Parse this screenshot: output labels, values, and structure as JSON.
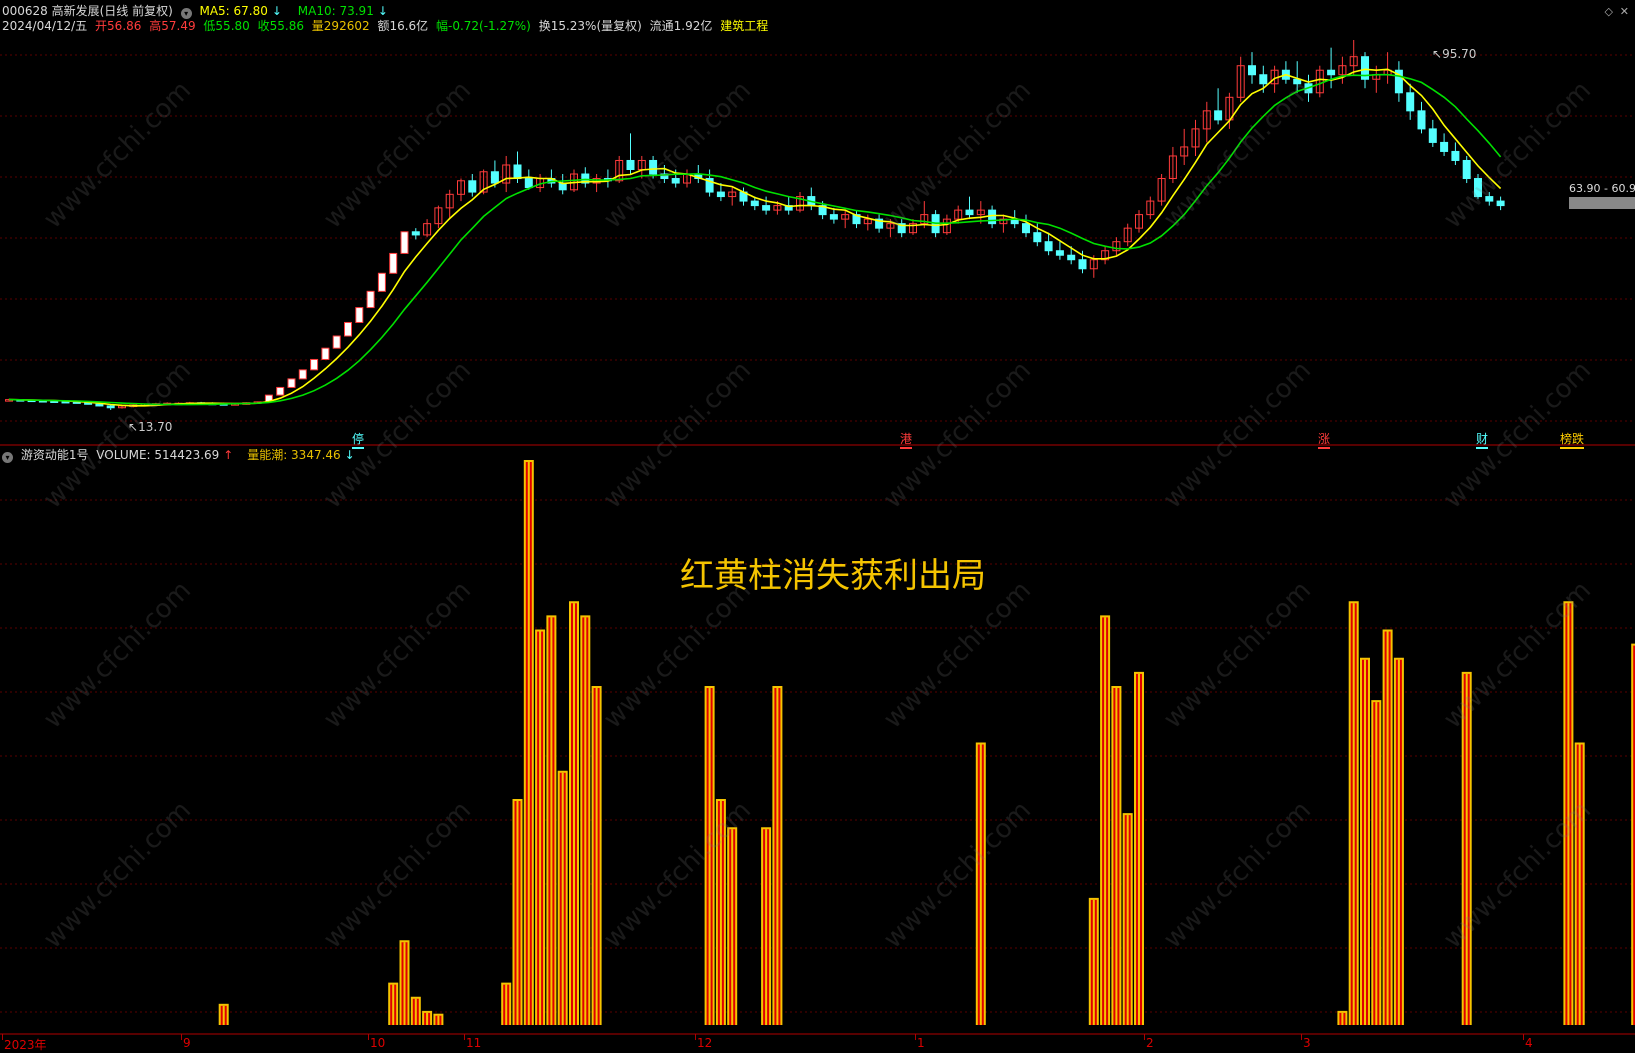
{
  "header1": {
    "code_name": "000628 高新发展(日线 前复权)",
    "ma5": "MA5: 67.80",
    "ma5_arrow": "↓",
    "ma10": "MA10: 73.91",
    "ma10_arrow": "↓"
  },
  "header2": {
    "date": "2024/04/12/五",
    "open": "开56.86",
    "high": "高57.49",
    "low": "低55.80",
    "close": "收55.86",
    "volume": "量292602",
    "amount": "额16.6亿",
    "change": "幅-0.72(-1.27%)",
    "turnover": "换15.23%(量复权)",
    "float": "流通1.92亿",
    "sector": "建筑工程"
  },
  "lower_header": {
    "indicator": "游资动能1号",
    "volume_label": "VOLUME: 514423.69",
    "volume_arrow": "↑",
    "energy_label": "量能潮: 3347.46",
    "energy_arrow": "↓"
  },
  "price_labels": {
    "high_mark": "95.70",
    "low_mark": "13.70",
    "range_tag": "63.90 - 60.9"
  },
  "event_tags": [
    "停",
    "港",
    "涨",
    "财",
    "榜跌"
  ],
  "annotation": "红黄柱消失获利出局",
  "watermark": "www.cfchi.com",
  "x_axis_labels": [
    "2023年",
    "9",
    "10",
    "11",
    "12",
    "1",
    "2",
    "3",
    "4"
  ],
  "colors": {
    "up": "#ff3b3b",
    "down": "#54ffff",
    "ma5": "#ffff00",
    "ma10": "#00e000",
    "bar_edge": "#f5c400",
    "bar_fill": "#e00000"
  },
  "chart_data": {
    "type": "candlestick",
    "price_scale": [
      13.7,
      95.7
    ],
    "candles_ohlc": [
      [
        16,
        16.2,
        15.8,
        16
      ],
      [
        16,
        16.1,
        15.8,
        15.9
      ],
      [
        15.9,
        16,
        15.7,
        15.8
      ],
      [
        15.8,
        16,
        15.6,
        15.7
      ],
      [
        15.7,
        15.9,
        15.5,
        15.6
      ],
      [
        15.6,
        15.8,
        15.4,
        15.5
      ],
      [
        15.5,
        15.7,
        15.2,
        15.3
      ],
      [
        15.3,
        15.5,
        14.9,
        15
      ],
      [
        15,
        15.2,
        14.5,
        14.6
      ],
      [
        14.6,
        14.9,
        13.7,
        14.2
      ],
      [
        14.2,
        14.8,
        14,
        14.6
      ],
      [
        14.6,
        15,
        14.3,
        14.8
      ],
      [
        14.8,
        15.1,
        14.5,
        15
      ],
      [
        15,
        15.3,
        14.8,
        15.1
      ],
      [
        15.1,
        15.4,
        14.9,
        15.2
      ],
      [
        15.2,
        15.4,
        15,
        15.2
      ],
      [
        15.2,
        15.5,
        15,
        15.3
      ],
      [
        15.3,
        15.5,
        15.1,
        15.2
      ],
      [
        15.2,
        15.4,
        15,
        15.1
      ],
      [
        15.1,
        15.3,
        14.9,
        15
      ],
      [
        15,
        15.2,
        14.8,
        15.1
      ],
      [
        15.1,
        15.4,
        14.9,
        15.3
      ],
      [
        15.3,
        15.6,
        15.1,
        15.5
      ],
      [
        15.5,
        17,
        15.5,
        17
      ],
      [
        17,
        18.7,
        17,
        18.7
      ],
      [
        18.7,
        20.6,
        18.7,
        20.6
      ],
      [
        20.6,
        22.6,
        20.6,
        22.6
      ],
      [
        22.6,
        24.9,
        22.6,
        24.9
      ],
      [
        24.9,
        27.4,
        24.9,
        27.4
      ],
      [
        27.4,
        30.1,
        27.4,
        30.1
      ],
      [
        30.1,
        33.1,
        30.1,
        33.1
      ],
      [
        33.1,
        36.4,
        33.1,
        36.4
      ],
      [
        36.4,
        40,
        36.4,
        40
      ],
      [
        40,
        44,
        40,
        44
      ],
      [
        44,
        48.4,
        44,
        48.4
      ],
      [
        48.4,
        53.2,
        48.4,
        53.2
      ],
      [
        53.2,
        54,
        51.5,
        52.5
      ],
      [
        52.5,
        56,
        52,
        55
      ],
      [
        55,
        59,
        54,
        58.5
      ],
      [
        58.5,
        62.5,
        56,
        61.5
      ],
      [
        61.5,
        65,
        60,
        64.5
      ],
      [
        64.5,
        66,
        61,
        62
      ],
      [
        62,
        67,
        61.5,
        66.5
      ],
      [
        66.5,
        69,
        63,
        64
      ],
      [
        64,
        70,
        62,
        68
      ],
      [
        68,
        71,
        64,
        65
      ],
      [
        65,
        67,
        62.5,
        63
      ],
      [
        63,
        66,
        62,
        65
      ],
      [
        65,
        67,
        63,
        64
      ],
      [
        64,
        66,
        61.5,
        62.5
      ],
      [
        62.5,
        67,
        62,
        66
      ],
      [
        66,
        67.5,
        63,
        64
      ],
      [
        64,
        66,
        62,
        65
      ],
      [
        65,
        67,
        63,
        64.5
      ],
      [
        64.5,
        70,
        64,
        69
      ],
      [
        69,
        75,
        66,
        67
      ],
      [
        67,
        70,
        65,
        69
      ],
      [
        69,
        70,
        65,
        66
      ],
      [
        66,
        68,
        64,
        65
      ],
      [
        65,
        67,
        63,
        64
      ],
      [
        64,
        67,
        63,
        66
      ],
      [
        66,
        68,
        64,
        65
      ],
      [
        65,
        67,
        61,
        62
      ],
      [
        62,
        64,
        60,
        61
      ],
      [
        61,
        63,
        59,
        62
      ],
      [
        62,
        63,
        59,
        60
      ],
      [
        60,
        61,
        58,
        59
      ],
      [
        59,
        61,
        57,
        58
      ],
      [
        58,
        60,
        57,
        59
      ],
      [
        59,
        61,
        57,
        58
      ],
      [
        58,
        62,
        57.5,
        61
      ],
      [
        61,
        63,
        58,
        59
      ],
      [
        59,
        60,
        56,
        57
      ],
      [
        57,
        58.5,
        55,
        56
      ],
      [
        56,
        58,
        54,
        57
      ],
      [
        57,
        58,
        54,
        55
      ],
      [
        55,
        57,
        53.5,
        56
      ],
      [
        56,
        57,
        53,
        54
      ],
      [
        54,
        56,
        52,
        55
      ],
      [
        55,
        56,
        52,
        53
      ],
      [
        53,
        56,
        52.5,
        55
      ],
      [
        55,
        60,
        54,
        57
      ],
      [
        57,
        58,
        52,
        53
      ],
      [
        53,
        57,
        52.5,
        56
      ],
      [
        56,
        59,
        55,
        58
      ],
      [
        58,
        61,
        56,
        57
      ],
      [
        57,
        60,
        55,
        58
      ],
      [
        58,
        59,
        54,
        55
      ],
      [
        55,
        57,
        53,
        56
      ],
      [
        56,
        58,
        54,
        55
      ],
      [
        55,
        57,
        52,
        53
      ],
      [
        53,
        55,
        50,
        51
      ],
      [
        51,
        53,
        48,
        49
      ],
      [
        49,
        51,
        47,
        48
      ],
      [
        48,
        50,
        46,
        47
      ],
      [
        47,
        49,
        44,
        45
      ],
      [
        45,
        48,
        43,
        47
      ],
      [
        47,
        50,
        46,
        49
      ],
      [
        49,
        52,
        48,
        51
      ],
      [
        51,
        55,
        50,
        54
      ],
      [
        54,
        58,
        53,
        57
      ],
      [
        57,
        61,
        56,
        60
      ],
      [
        60,
        66,
        59,
        65
      ],
      [
        65,
        72,
        64,
        70
      ],
      [
        70,
        76,
        68,
        72
      ],
      [
        72,
        78,
        70,
        76
      ],
      [
        76,
        82,
        73,
        80
      ],
      [
        80,
        85,
        77,
        78
      ],
      [
        78,
        84,
        76,
        83
      ],
      [
        83,
        92,
        82,
        90
      ],
      [
        90,
        93,
        86,
        88
      ],
      [
        88,
        90,
        84,
        86
      ],
      [
        86,
        90,
        84,
        89
      ],
      [
        89,
        91,
        86,
        87
      ],
      [
        87,
        91,
        84,
        86
      ],
      [
        86,
        88,
        82,
        84
      ],
      [
        84,
        90,
        83,
        89
      ],
      [
        89,
        94,
        85,
        88
      ],
      [
        88,
        92,
        86,
        90
      ],
      [
        90,
        95.7,
        88,
        92
      ],
      [
        92,
        93,
        85,
        87
      ],
      [
        87,
        90,
        84,
        88
      ],
      [
        88,
        93,
        86,
        89
      ],
      [
        89,
        91,
        82,
        84
      ],
      [
        84,
        86,
        78,
        80
      ],
      [
        80,
        82,
        75,
        76
      ],
      [
        76,
        78,
        72,
        73
      ],
      [
        73,
        75,
        70,
        71
      ],
      [
        71,
        73,
        68,
        69
      ],
      [
        69,
        70,
        64,
        65
      ],
      [
        65,
        66,
        60.5,
        61
      ],
      [
        61,
        62,
        59,
        60
      ],
      [
        60,
        61,
        58,
        59
      ]
    ],
    "volume_bars": [
      [
        19,
        0.15
      ],
      [
        34,
        0.3
      ],
      [
        35,
        0.6
      ],
      [
        36,
        0.2
      ],
      [
        37,
        0.1
      ],
      [
        38,
        0.08
      ],
      [
        44,
        0.3
      ],
      [
        45,
        1.6
      ],
      [
        46,
        4.0
      ],
      [
        47,
        2.8
      ],
      [
        48,
        2.9
      ],
      [
        49,
        1.8
      ],
      [
        50,
        3.0
      ],
      [
        51,
        2.9
      ],
      [
        52,
        2.4
      ],
      [
        62,
        2.4
      ],
      [
        63,
        1.6
      ],
      [
        64,
        1.4
      ],
      [
        67,
        1.4
      ],
      [
        68,
        2.4
      ],
      [
        86,
        2.0
      ],
      [
        96,
        0.9
      ],
      [
        97,
        2.9
      ],
      [
        98,
        2.4
      ],
      [
        99,
        1.5
      ],
      [
        100,
        2.5
      ],
      [
        118,
        0.1
      ],
      [
        119,
        3.0
      ],
      [
        120,
        2.6
      ],
      [
        121,
        2.3
      ],
      [
        122,
        2.8
      ],
      [
        123,
        2.6
      ],
      [
        129,
        2.5
      ],
      [
        138,
        3.0
      ],
      [
        139,
        2.0
      ],
      [
        144,
        2.7
      ]
    ]
  }
}
